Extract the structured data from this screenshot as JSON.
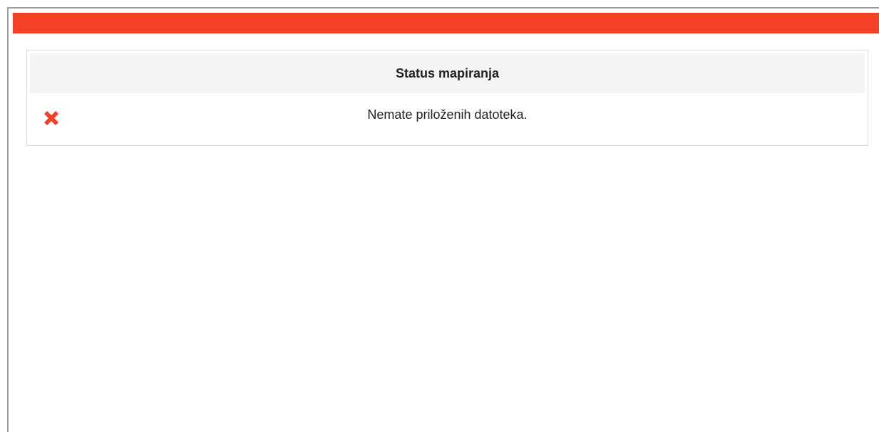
{
  "header": {
    "bar_color": "#f44125"
  },
  "mapping_status": {
    "title": "Status mapiranja",
    "icon": "close-icon",
    "icon_color": "#f44125",
    "message": "Nemate priloženih datoteka."
  }
}
